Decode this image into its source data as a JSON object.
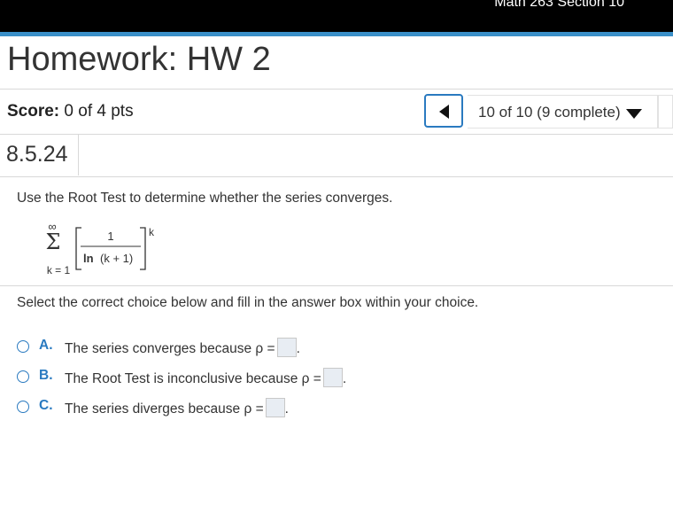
{
  "header": {
    "course": "Math 263 Section 10"
  },
  "homework": {
    "title": "Homework: HW 2"
  },
  "score": {
    "label": "Score:",
    "value": "0 of 4 pts"
  },
  "navigation": {
    "question_select": "10 of 10 (9 complete)"
  },
  "question": {
    "number": "8.5.24",
    "prompt": "Use the Root Test to determine whether the series converges.",
    "formula": {
      "sum_upper": "∞",
      "sum_symbol": "Σ",
      "sum_lower": "k = 1",
      "numerator": "1",
      "denominator_fn": "ln",
      "denominator_arg": "(k + 1)",
      "exponent": "k"
    },
    "instruction": "Select the correct choice below and fill in the answer box within your choice.",
    "choices": [
      {
        "letter": "A.",
        "text": "The series converges because ρ ="
      },
      {
        "letter": "B.",
        "text": "The Root Test is inconclusive because ρ ="
      },
      {
        "letter": "C.",
        "text": "The series diverges because ρ ="
      }
    ]
  }
}
